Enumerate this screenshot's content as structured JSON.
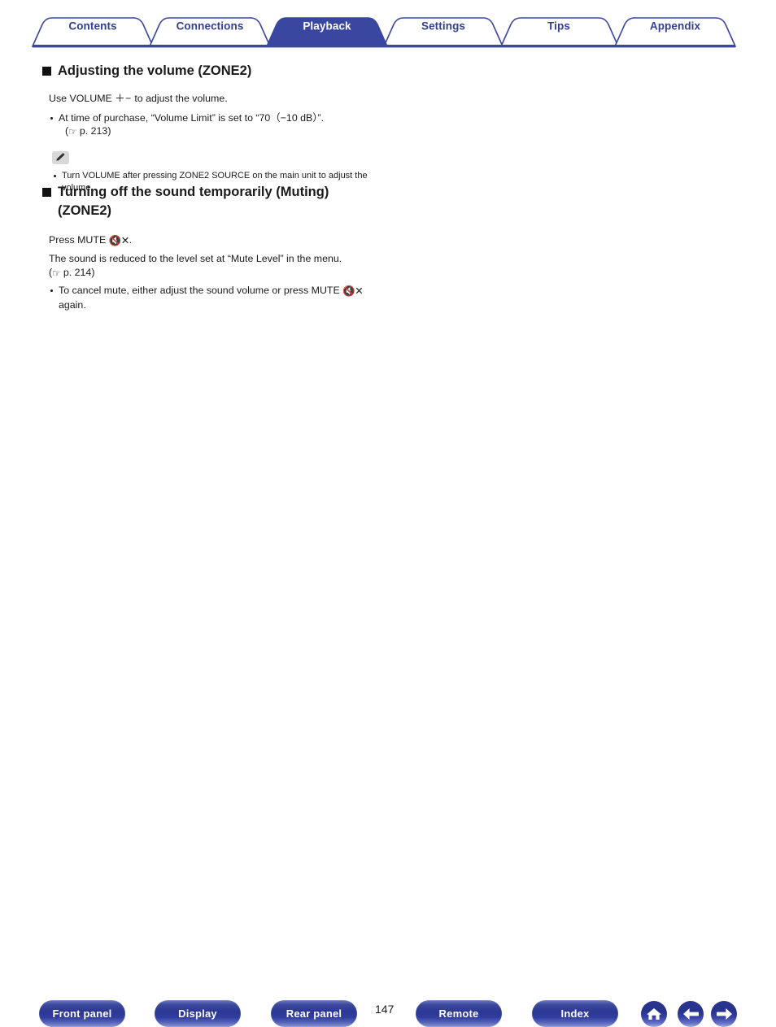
{
  "tabs": [
    {
      "label": "Contents",
      "active": false
    },
    {
      "label": "Connections",
      "active": false
    },
    {
      "label": "Playback",
      "active": true
    },
    {
      "label": "Settings",
      "active": false
    },
    {
      "label": "Tips",
      "active": false
    },
    {
      "label": "Appendix",
      "active": false
    }
  ],
  "sections": [
    {
      "heading": "Adjusting the volume (ZONE2)",
      "intro_pre": "Use VOLUME ",
      "intro_symbol": "＋−",
      "intro_post": " to adjust the volume.",
      "bullet": "At time of purchase, “Volume Limit” is set to “70（−10 dB）”.",
      "pageref_hand": "☞",
      "pageref_text": "p. 213",
      "note": {
        "icon": "pencil-icon",
        "bullet_line1": "Turn VOLUME after pressing ZONE2 SOURCE on the main unit to adjust the",
        "bullet_line2": "volume."
      }
    },
    {
      "heading_line1": "Turning off the sound temporarily (Muting)",
      "heading_line2": "(ZONE2)",
      "press_pre": "Press MUTE ",
      "press_post": ".",
      "detail": "The sound is reduced to the level set at “Mute Level” in the menu.",
      "pageref_hand": "☞",
      "pageref_text": "p. 214",
      "bullet_pre": "To cancel mute, either adjust the sound volume or press MUTE ",
      "bullet_post": "",
      "bullet_line2": "again."
    }
  ],
  "footer": {
    "buttons": [
      {
        "label": "Front panel"
      },
      {
        "label": "Display"
      },
      {
        "label": "Rear panel"
      },
      {
        "label": "Remote"
      },
      {
        "label": "Index"
      }
    ],
    "page_number": "147",
    "icons": [
      {
        "name": "home-icon"
      },
      {
        "name": "arrow-left-icon"
      },
      {
        "name": "arrow-right-icon"
      }
    ]
  },
  "colors": {
    "accent": "#33408f",
    "accent_dark": "#2b3792",
    "tab_active_bg": "#3a47a0",
    "text": "#1a1a1a"
  }
}
